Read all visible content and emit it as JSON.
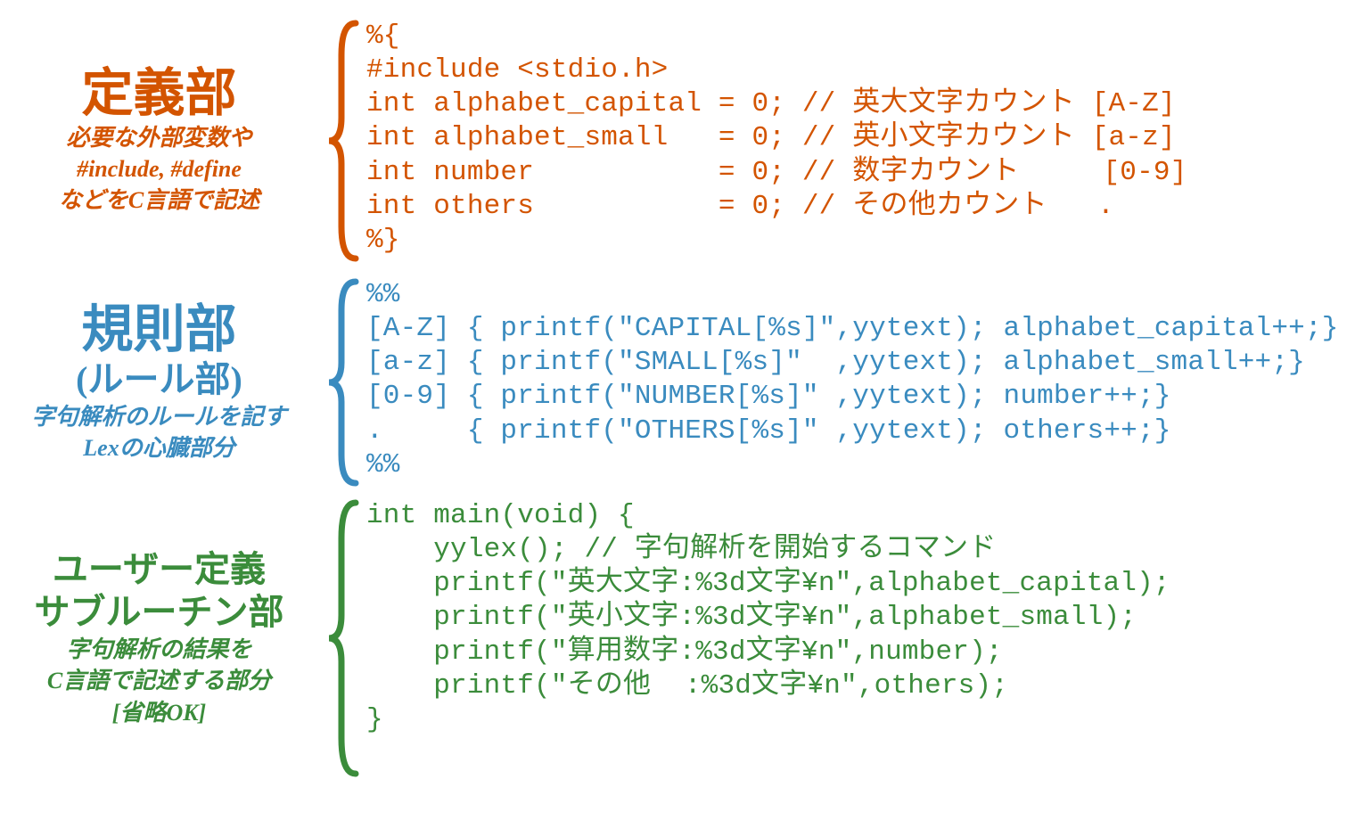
{
  "section1": {
    "title": "定義部",
    "desc1": "必要な外部変数や",
    "desc2": "#include, #define",
    "desc3": "などをC言語で記述",
    "color": "#d35400",
    "code": "%{\n#include <stdio.h>\nint alphabet_capital = 0; // 英大文字カウント [A-Z]\nint alphabet_small   = 0; // 英小文字カウント [a-z]\nint number           = 0; // 数字カウント     [0-9]\nint others           = 0; // その他カウント   .\n%}"
  },
  "section2": {
    "title": "規則部",
    "subtitle": "(ルール部)",
    "desc1": "字句解析のルールを記す",
    "desc2": "Lexの心臓部分",
    "color": "#3a8bbf",
    "code": "%%\n[A-Z] { printf(\"CAPITAL[%s]\",yytext); alphabet_capital++;}\n[a-z] { printf(\"SMALL[%s]\"  ,yytext); alphabet_small++;}\n[0-9] { printf(\"NUMBER[%s]\" ,yytext); number++;}\n.     { printf(\"OTHERS[%s]\" ,yytext); others++;}\n%%"
  },
  "section3": {
    "title1": "ユーザー定義",
    "title2": "サブルーチン部",
    "desc1": "字句解析の結果を",
    "desc2": "C言語で記述する部分",
    "desc3": "[省略OK]",
    "color": "#3b8c3b",
    "code": "int main(void) {\n    yylex(); // 字句解析を開始するコマンド\n    printf(\"英大文字:%3d文字¥n\",alphabet_capital);\n    printf(\"英小文字:%3d文字¥n\",alphabet_small);\n    printf(\"算用数字:%3d文字¥n\",number);\n    printf(\"その他  :%3d文字¥n\",others);\n}"
  }
}
